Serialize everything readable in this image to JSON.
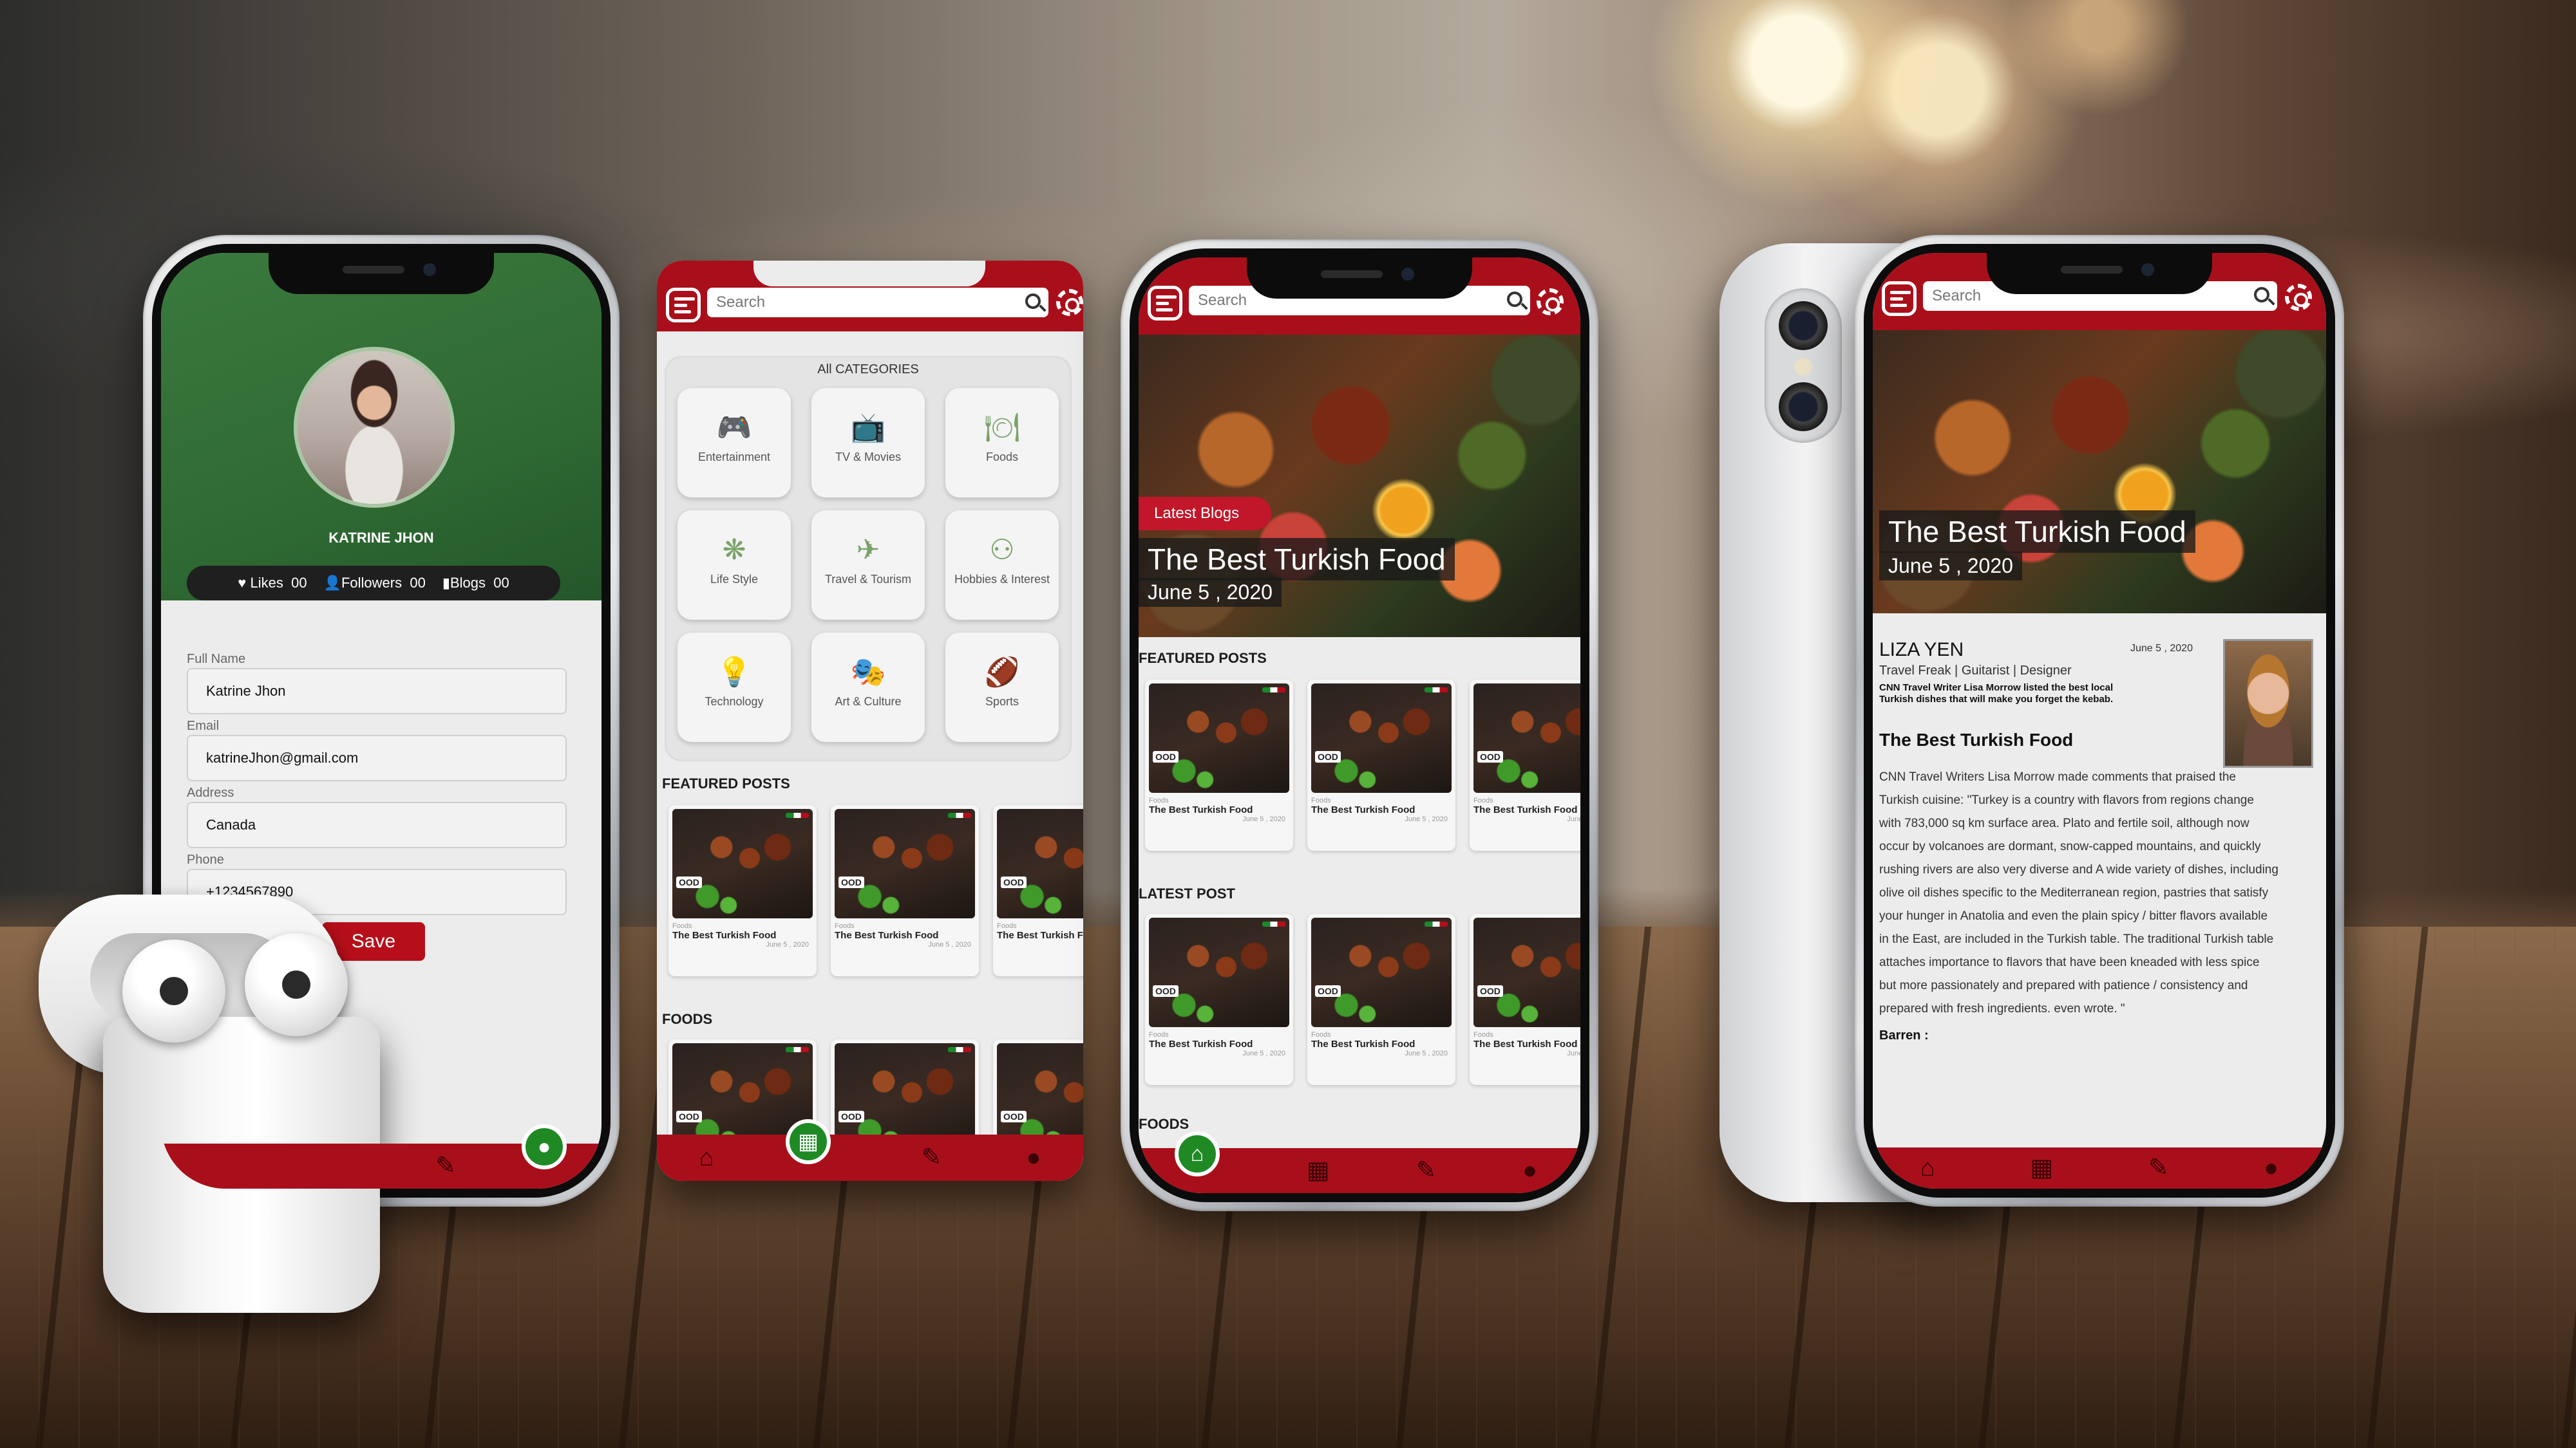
{
  "search": {
    "placeholder": "Search"
  },
  "profile": {
    "name": "KATRINE JHON",
    "stats": [
      {
        "label": "Likes",
        "value": "00"
      },
      {
        "label": "Followers",
        "value": "00"
      },
      {
        "label": "Blogs",
        "value": "00"
      }
    ],
    "fields": [
      {
        "label": "Full Name",
        "value": "Katrine Jhon"
      },
      {
        "label": "Email",
        "value": "katrineJhon@gmail.com"
      },
      {
        "label": "Address",
        "value": "Canada"
      },
      {
        "label": "Phone",
        "value": "+1234567890"
      }
    ],
    "save_label": "Save"
  },
  "categories": {
    "title": "All CATEGORIES",
    "items": [
      {
        "label": "Entertainment",
        "icon": "gamepad-icon"
      },
      {
        "label": "TV & Movies",
        "icon": "tv-icon"
      },
      {
        "label": "Foods",
        "icon": "food-icon"
      },
      {
        "label": "Life Style",
        "icon": "lifestyle-icon"
      },
      {
        "label": "Travel & Tourism",
        "icon": "plane-icon"
      },
      {
        "label": "Hobbies & Interest",
        "icon": "binoculars-icon"
      },
      {
        "label": "Technology",
        "icon": "lightbulb-icon"
      },
      {
        "label": "Art & Culture",
        "icon": "masks-icon"
      },
      {
        "label": "Sports",
        "icon": "ball-icon"
      }
    ]
  },
  "sections": {
    "featured": "FEATURED POSTS",
    "foods": "FOODS",
    "latest": "LATEST POST"
  },
  "post": {
    "category": "Foods",
    "title": "The Best Turkish Food",
    "date": "June 5 , 2020",
    "badge": "OOD"
  },
  "hero": {
    "tag": "Latest Blogs",
    "title": "The Best Turkish Food",
    "date": "June 5 , 2020"
  },
  "article": {
    "author": "LIZA YEN",
    "date": "June 5 , 2020",
    "bio": "Travel Freak | Guitarist | Designer",
    "summary": "CNN Travel Writer Lisa Morrow listed the best local Turkish dishes that will make you forget the kebab.",
    "heading": "The Best Turkish Food",
    "body": "CNN Travel Writers Lisa Morrow made comments that praised the Turkish cuisine: \"Turkey is a country with flavors from regions change with 783,000 sq km surface area. Plato and fertile soil, although now occur by volcanoes are dormant, snow-capped mountains, and quickly rushing rivers are also very diverse and A wide variety of dishes, including olive oil dishes specific to the Mediterranean region, pastries that satisfy your hunger in Anatolia and even the plain spicy / bitter flavors available in the East, are included in the Turkish table. The traditional Turkish table attaches importance to flavors that have been kneaded with less spice but more passionately and prepared with patience / consistency and prepared with fresh ingredients. even wrote. \"",
    "footer": "Barren :"
  },
  "colors": {
    "brand_red": "#a90f1a",
    "brand_green": "#2f6a33",
    "fab_green": "#1f8a24"
  }
}
